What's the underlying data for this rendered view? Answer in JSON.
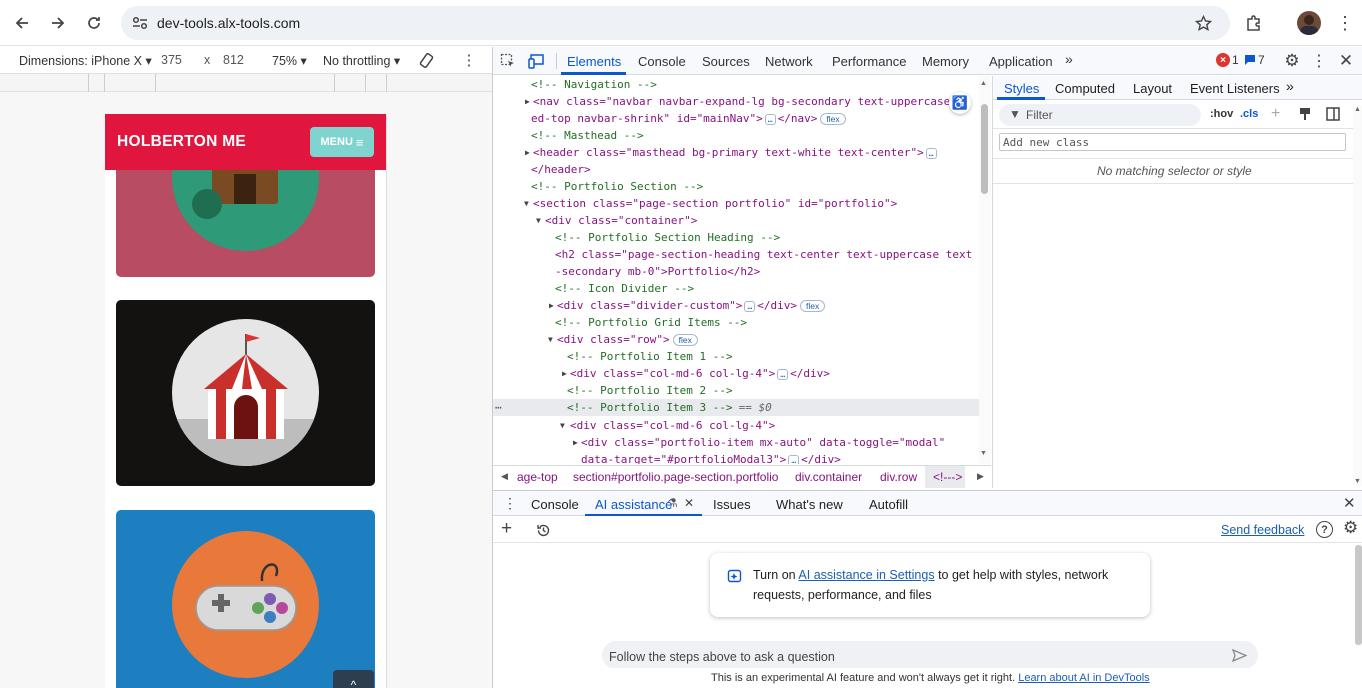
{
  "browser": {
    "url": "dev-tools.alx-tools.com"
  },
  "device_toolbar": {
    "dimensions_label": "Dimensions: iPhone X",
    "width": "375",
    "x": "x",
    "height": "812",
    "zoom": "75%",
    "throttling": "No throttling"
  },
  "page": {
    "brand": "HOLBERTON ME",
    "menu_label": "MENU"
  },
  "devtools": {
    "tabs": [
      "Elements",
      "Console",
      "Sources",
      "Network",
      "Performance",
      "Memory",
      "Application"
    ],
    "error_count": "1",
    "message_count": "7",
    "styles_tabs": [
      "Styles",
      "Computed",
      "Layout",
      "Event Listeners"
    ],
    "filter_placeholder": "Filter",
    "hov": ":hov",
    "cls": ".cls",
    "add_class_placeholder": "Add new class",
    "no_match": "No matching selector or style",
    "breadcrumbs": [
      "age-top",
      "section#portfolio.page-section.portfolio",
      "div.container",
      "div.row",
      "<!--->"
    ],
    "drawer_tabs": [
      "Console",
      "AI assistance",
      "Issues",
      "What's new",
      "Autofill"
    ],
    "send_feedback": "Send feedback",
    "ai_card_text_before": "Turn on ",
    "ai_card_link": "AI assistance in Settings",
    "ai_card_text_after": " to get help with styles, network",
    "ai_card_text_line2": "requests, performance, and files",
    "ask_placeholder": "Follow the steps above to ask a question",
    "footer_text": "This is an experimental AI feature and won't always get it right. ",
    "footer_link": "Learn about AI in DevTools"
  },
  "dom_lines": [
    {
      "t": "<!-- Navigation -->"
    },
    {
      "t": "<nav class=\"navbar navbar-expand-lg bg-secondary text-uppercase f"
    },
    {
      "t": "ed-top navbar-shrink\" id=\"mainNav\">"
    },
    {
      "t": "<!-- Masthead -->"
    },
    {
      "t": "<header class=\"masthead bg-primary text-white text-center\">"
    },
    {
      "t": "</header>"
    },
    {
      "t": "<!-- Portfolio Section -->"
    },
    {
      "t": "<section class=\"page-section portfolio\" id=\"portfolio\">"
    },
    {
      "t": "<div class=\"container\">"
    },
    {
      "t": "<!-- Portfolio Section Heading -->"
    },
    {
      "t": "<h2 class=\"page-section-heading text-center text-uppercase text"
    },
    {
      "t": "-secondary mb-0\">Portfolio</h2>"
    },
    {
      "t": "<!-- Icon Divider -->"
    },
    {
      "t": "<div class=\"divider-custom\">"
    },
    {
      "t": "<!-- Portfolio Grid Items -->"
    },
    {
      "t": "<div class=\"row\">"
    },
    {
      "t": "<!-- Portfolio Item 1 -->"
    },
    {
      "t": "<div class=\"col-md-6 col-lg-4\">"
    },
    {
      "t": "<!-- Portfolio Item 2 -->"
    },
    {
      "t": "<!-- Portfolio Item 3 -->"
    },
    {
      "t": "<div class=\"col-md-6 col-lg-4\">"
    },
    {
      "t": "<div class=\"portfolio-item mx-auto\" data-toggle=\"modal\""
    },
    {
      "t": "data-target=\"#portfolioModal3\">"
    }
  ],
  "dom_suffix": {
    "close_nav": "</nav>",
    "close_div": "</div>",
    "selected": "== $0",
    "flex": "flex",
    "dots": "…"
  },
  "colors": {
    "navbar": "#e0163f",
    "menu_button": "#7fd4d0",
    "card1": "#b84c62",
    "card2": "#141111",
    "card3": "#1d7fc0",
    "accent": "#0b57d0"
  }
}
